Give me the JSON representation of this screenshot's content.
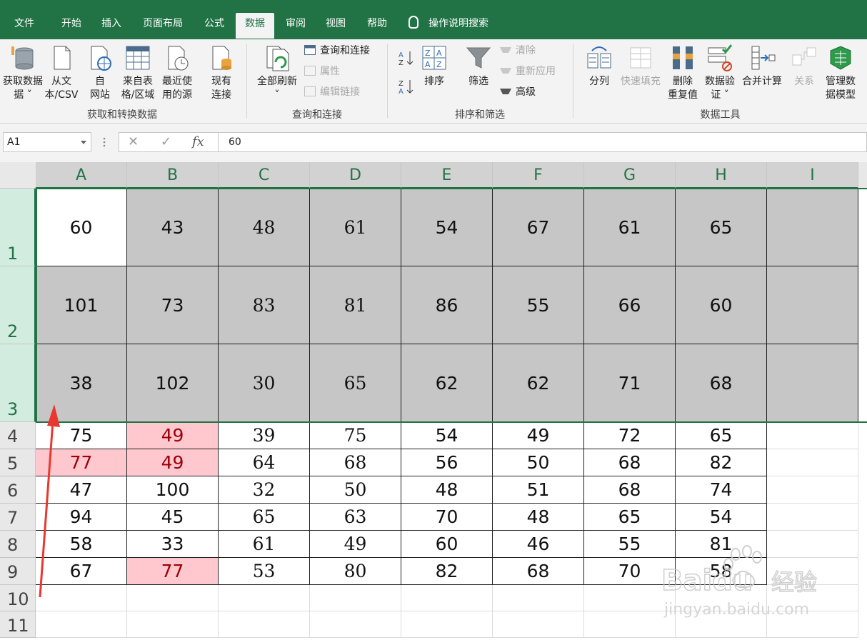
{
  "tabs": [
    {
      "label": "文件"
    },
    {
      "label": "开始"
    },
    {
      "label": "插入"
    },
    {
      "label": "页面布局"
    },
    {
      "label": "公式"
    },
    {
      "label": "数据"
    },
    {
      "label": "审阅"
    },
    {
      "label": "视图"
    },
    {
      "label": "帮助"
    }
  ],
  "search_label": "操作说明搜索",
  "ribbon": {
    "get_data": "获取数据",
    "get_data_2": "据 ˅",
    "from_text_1": "从文",
    "from_text_2": "本/CSV",
    "from_web_1": "自",
    "from_web_2": "网站",
    "from_table_1": "来自表",
    "from_table_2": "格/区域",
    "recent_1": "最近使",
    "recent_2": "用的源",
    "existing_1": "现有",
    "existing_2": "连接",
    "group1": "获取和转换数据",
    "refresh_all": "全部刷新",
    "refresh_caret": "˅",
    "queries": "查询和连接",
    "properties": "属性",
    "edit_links": "编辑链接",
    "group2": "查询和连接",
    "sort": "排序",
    "filter": "筛选",
    "clear": "清除",
    "reapply": "重新应用",
    "advanced": "高级",
    "group3": "排序和筛选",
    "text_to_columns": "分列",
    "flash_fill": "快速填充",
    "remove_dup_1": "删除",
    "remove_dup_2": "重复值",
    "validation_1": "数据验",
    "validation_2": "证 ˅",
    "consolidate": "合并计算",
    "relationships": "关系",
    "data_model_1": "管理数",
    "data_model_2": "据模型",
    "group4": "数据工具"
  },
  "formula_bar": {
    "name_box": "A1",
    "formula": "60",
    "fx": "fx"
  },
  "columns": [
    "A",
    "B",
    "C",
    "D",
    "E",
    "F",
    "G",
    "H",
    "I"
  ],
  "rows": [
    "1",
    "2",
    "3",
    "4",
    "5",
    "6",
    "7",
    "8",
    "9",
    "10",
    "11"
  ],
  "cells": [
    [
      "60",
      "43",
      "48",
      "61",
      "54",
      "67",
      "61",
      "65"
    ],
    [
      "101",
      "73",
      "83",
      "81",
      "86",
      "55",
      "66",
      "60"
    ],
    [
      "38",
      "102",
      "30",
      "65",
      "62",
      "62",
      "71",
      "68"
    ],
    [
      "75",
      "49",
      "39",
      "75",
      "54",
      "49",
      "72",
      "65"
    ],
    [
      "77",
      "49",
      "64",
      "68",
      "56",
      "50",
      "68",
      "82"
    ],
    [
      "47",
      "100",
      "32",
      "50",
      "48",
      "51",
      "68",
      "74"
    ],
    [
      "94",
      "45",
      "65",
      "63",
      "70",
      "48",
      "65",
      "54"
    ],
    [
      "58",
      "33",
      "61",
      "49",
      "60",
      "46",
      "55",
      "81"
    ],
    [
      "67",
      "77",
      "53",
      "80",
      "82",
      "68",
      "70",
      "58"
    ]
  ],
  "pink_cells": [
    "3-1",
    "4-0",
    "4-1",
    "8-1"
  ],
  "colors": {
    "brand": "#217346",
    "selection_fill": "#c6c6c6",
    "highlight_fill": "#ffc7ce",
    "highlight_text": "#9c0006",
    "annotation_arrow": "#e8382f"
  },
  "watermark": {
    "brand": "Baidu",
    "product": "经验",
    "url": "jingyan.baidu.com"
  }
}
